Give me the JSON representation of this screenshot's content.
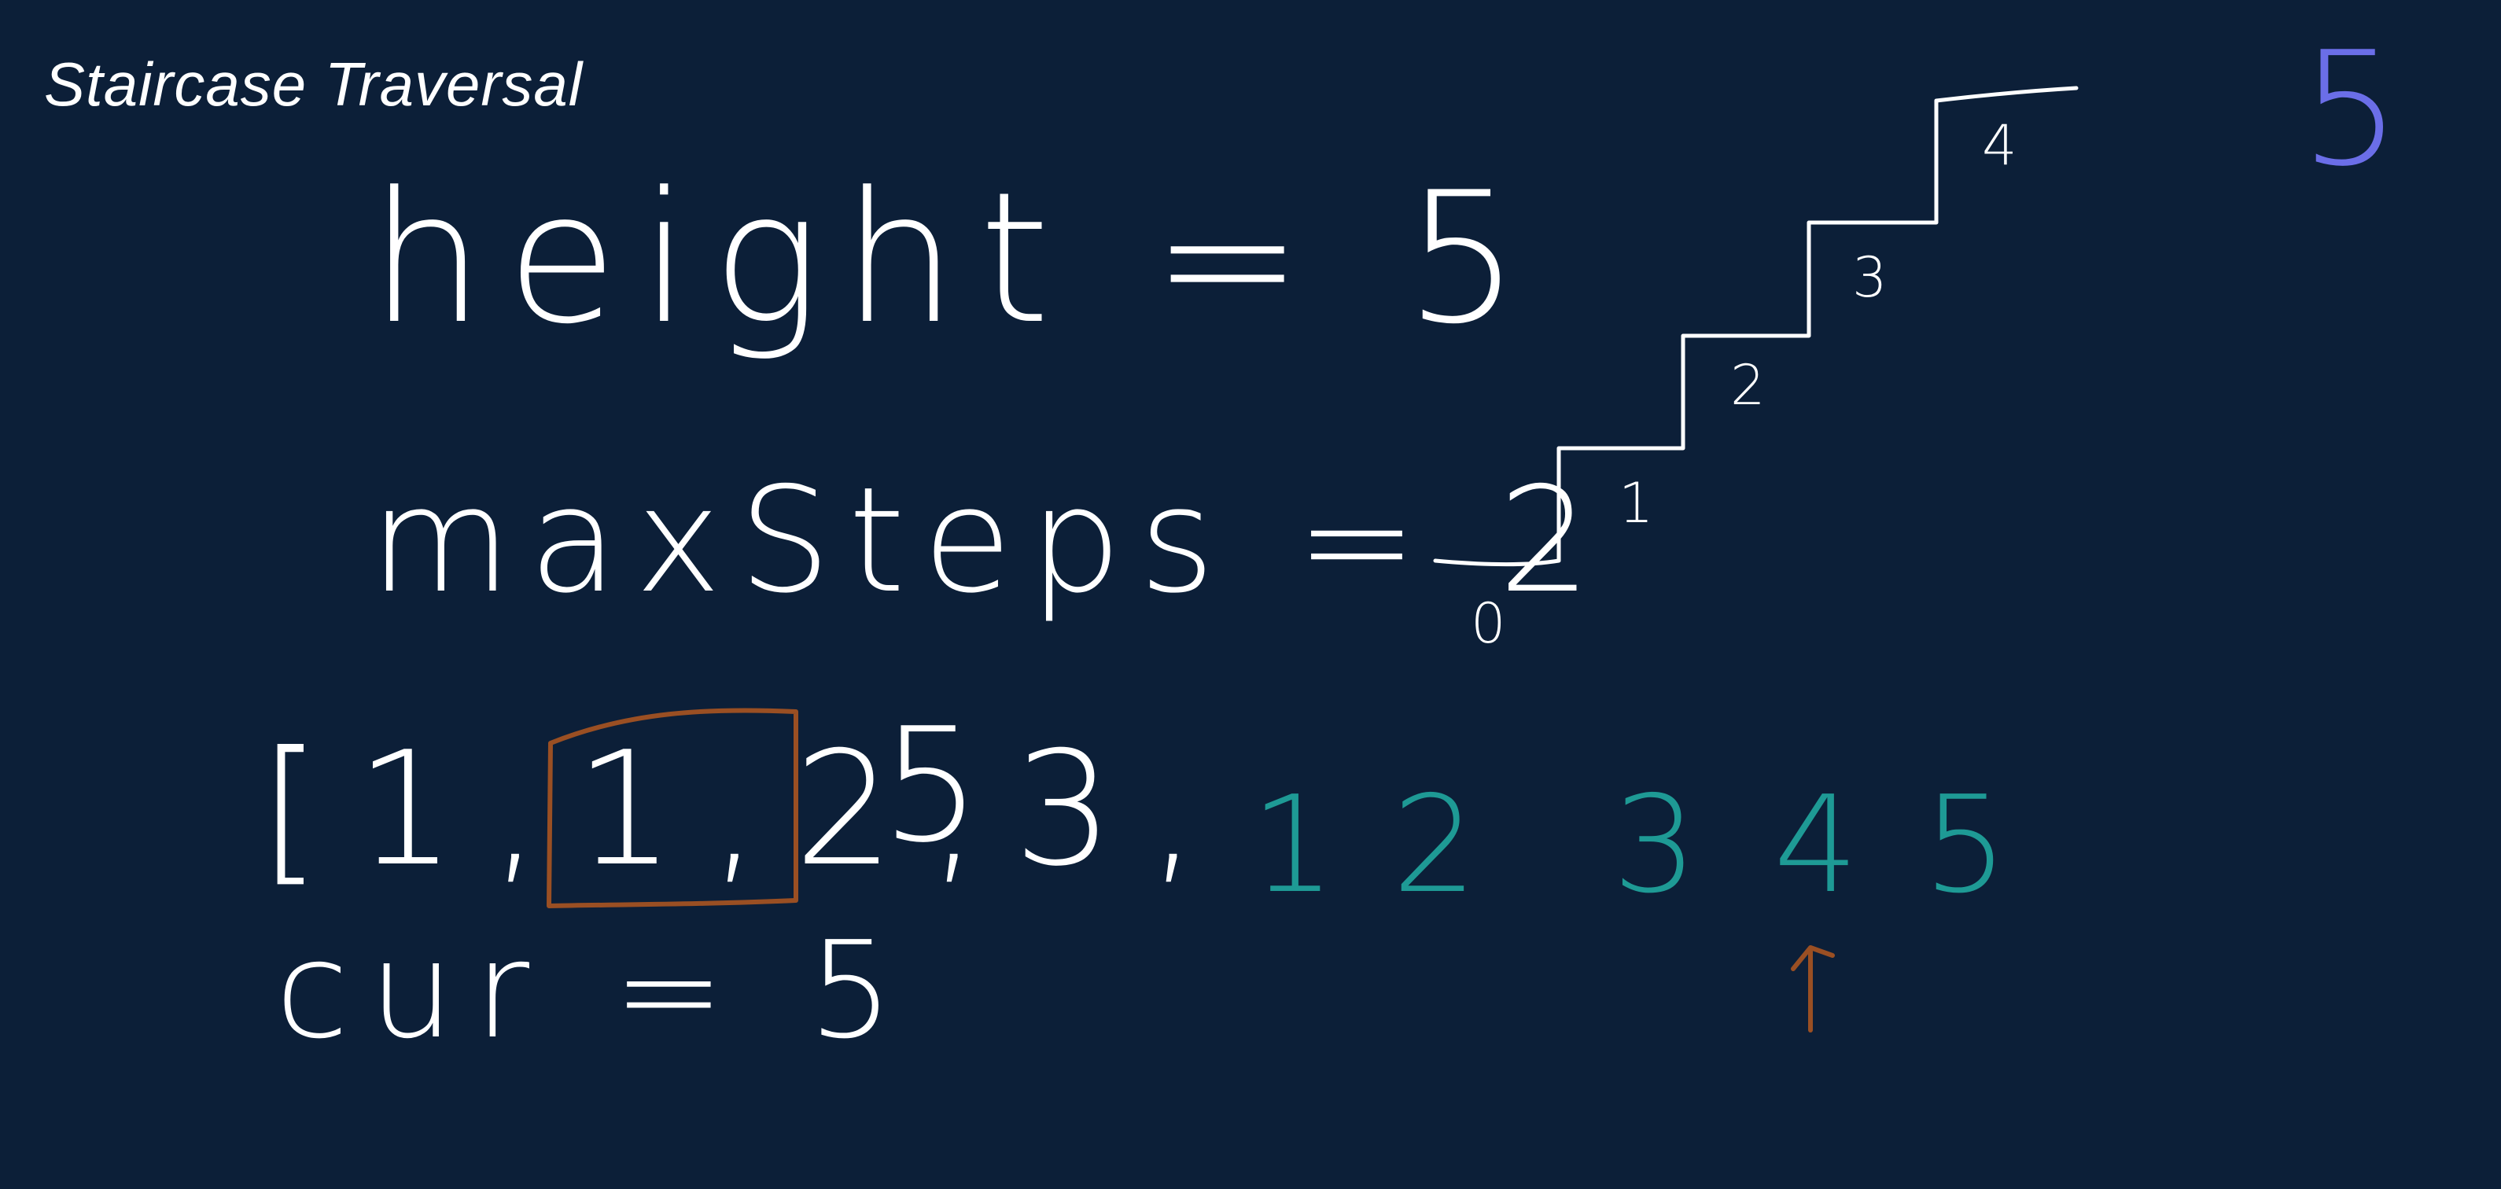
{
  "title": "Staircase Traversal",
  "height_line": "height = 5",
  "max_steps_line": "maxSteps = 2",
  "array_prefix": "[1,1,",
  "array_window": "2,3",
  "array_suffix": ",",
  "array_tail": "5",
  "cur_line": "cur = 5",
  "sequence": [
    "1",
    "2",
    "3",
    "4",
    "5"
  ],
  "corner_number": "5",
  "step_labels": [
    "0",
    "1",
    "2",
    "3",
    "4"
  ],
  "colors": {
    "background": "#0c1f38",
    "chalk": "#ffffff",
    "teal": "#1e9a95",
    "brown": "#9a4f23",
    "purple": "#6b6ee8"
  },
  "icons": [
    "pointer-arrow-icon"
  ]
}
